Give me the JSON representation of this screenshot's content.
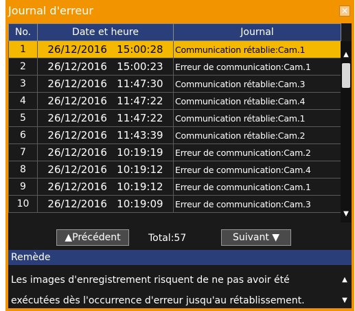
{
  "window": {
    "title": "Journal d'erreur",
    "close_icon": "close-icon"
  },
  "table": {
    "headers": [
      "No.",
      "Date et heure",
      "Journal"
    ],
    "rows": [
      {
        "no": "1",
        "datetime": "26/12/2016   15:00:28",
        "journal": "Communication rétablie:Cam.1",
        "selected": true
      },
      {
        "no": "2",
        "datetime": "26/12/2016   15:00:23",
        "journal": "Erreur de communication:Cam.1",
        "selected": false
      },
      {
        "no": "3",
        "datetime": "26/12/2016   11:47:30",
        "journal": "Communication rétablie:Cam.3",
        "selected": false
      },
      {
        "no": "4",
        "datetime": "26/12/2016   11:47:22",
        "journal": "Communication rétablie:Cam.4",
        "selected": false
      },
      {
        "no": "5",
        "datetime": "26/12/2016   11:47:22",
        "journal": "Communication rétablie:Cam.1",
        "selected": false
      },
      {
        "no": "6",
        "datetime": "26/12/2016   11:43:39",
        "journal": "Communication rétablie:Cam.2",
        "selected": false
      },
      {
        "no": "7",
        "datetime": "26/12/2016   10:19:19",
        "journal": "Erreur de communication:Cam.2",
        "selected": false
      },
      {
        "no": "8",
        "datetime": "26/12/2016   10:19:12",
        "journal": "Erreur de communication:Cam.4",
        "selected": false
      },
      {
        "no": "9",
        "datetime": "26/12/2016   10:19:12",
        "journal": "Erreur de communication:Cam.1",
        "selected": false
      },
      {
        "no": "10",
        "datetime": "26/12/2016   10:19:09",
        "journal": "Erreur de communication:Cam.3",
        "selected": false
      }
    ]
  },
  "navigation": {
    "prev_label": "▲Précédent",
    "total_label": "Total:57",
    "next_label": "Suivant ▼"
  },
  "remedy": {
    "heading": "Remède",
    "lines": [
      "Les images d'enregistrement risquent de ne pas avoir été",
      "exécutées dès l'occurrence d'erreur jusqu'au rétablissement."
    ]
  },
  "colors": {
    "frame": "#f29400",
    "header_bg": "#2a3f7a",
    "selected_row": "#f5b800",
    "panel_bg": "#1a1a1a"
  }
}
